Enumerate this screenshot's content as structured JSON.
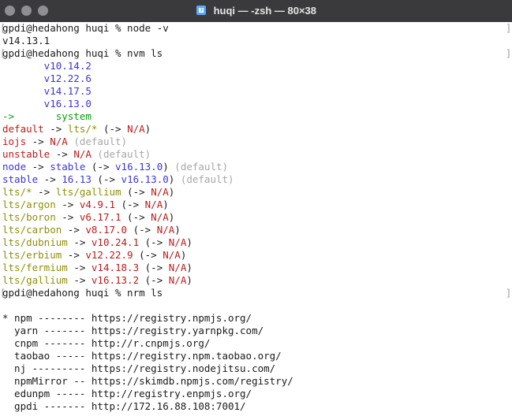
{
  "window": {
    "title": "huqi — -zsh — 80×38",
    "icon": "folder-document-icon",
    "colors": {
      "titlebar": "#3a3a3c",
      "blue": "#3b35d6",
      "green": "#0f9a0f",
      "red": "#b91c1c",
      "olive": "#8f8f0c",
      "gray": "#a7a7a7"
    }
  },
  "terminal": {
    "lines": [
      {
        "segments": [
          {
            "text": "gpdi@hedahong huqi % node -v",
            "color": "dark"
          }
        ],
        "bracket": true,
        "right_bracket": true
      },
      {
        "segments": [
          {
            "text": "v14.13.1",
            "color": "dark"
          }
        ]
      },
      {
        "segments": [
          {
            "text": "gpdi@hedahong huqi % nvm ls",
            "color": "dark"
          }
        ],
        "bracket": true,
        "right_bracket": true
      },
      {
        "segments": [
          {
            "text": "       v10.14.2",
            "color": "blue"
          }
        ]
      },
      {
        "segments": [
          {
            "text": "       v12.22.6",
            "color": "blue"
          }
        ]
      },
      {
        "segments": [
          {
            "text": "       v14.17.5",
            "color": "blue"
          }
        ]
      },
      {
        "segments": [
          {
            "text": "       v16.13.0",
            "color": "blue"
          }
        ]
      },
      {
        "segments": [
          {
            "text": "->       system",
            "color": "green"
          }
        ]
      },
      {
        "segments": [
          {
            "text": "default",
            "color": "red"
          },
          {
            "text": " -> ",
            "color": "dark"
          },
          {
            "text": "lts/*",
            "color": "olive"
          },
          {
            "text": " (-> ",
            "color": "dark"
          },
          {
            "text": "N/A",
            "color": "red"
          },
          {
            "text": ")",
            "color": "dark"
          }
        ]
      },
      {
        "segments": [
          {
            "text": "iojs",
            "color": "red"
          },
          {
            "text": " -> ",
            "color": "dark"
          },
          {
            "text": "N/A",
            "color": "red"
          },
          {
            "text": " (default)",
            "color": "gray"
          }
        ]
      },
      {
        "segments": [
          {
            "text": "unstable",
            "color": "red"
          },
          {
            "text": " -> ",
            "color": "dark"
          },
          {
            "text": "N/A",
            "color": "red"
          },
          {
            "text": " (default)",
            "color": "gray"
          }
        ]
      },
      {
        "segments": [
          {
            "text": "node",
            "color": "blue"
          },
          {
            "text": " -> ",
            "color": "dark"
          },
          {
            "text": "stable",
            "color": "blue"
          },
          {
            "text": " (-> ",
            "color": "dark"
          },
          {
            "text": "v16.13.0",
            "color": "blue"
          },
          {
            "text": ")",
            "color": "dark"
          },
          {
            "text": " (default)",
            "color": "gray"
          }
        ]
      },
      {
        "segments": [
          {
            "text": "stable",
            "color": "blue"
          },
          {
            "text": " -> ",
            "color": "dark"
          },
          {
            "text": "16.13",
            "color": "blue"
          },
          {
            "text": " (-> ",
            "color": "dark"
          },
          {
            "text": "v16.13.0",
            "color": "blue"
          },
          {
            "text": ")",
            "color": "dark"
          },
          {
            "text": " (default)",
            "color": "gray"
          }
        ]
      },
      {
        "segments": [
          {
            "text": "lts/*",
            "color": "olive"
          },
          {
            "text": " -> ",
            "color": "dark"
          },
          {
            "text": "lts/gallium",
            "color": "olive"
          },
          {
            "text": " (-> ",
            "color": "dark"
          },
          {
            "text": "N/A",
            "color": "red"
          },
          {
            "text": ")",
            "color": "dark"
          }
        ]
      },
      {
        "segments": [
          {
            "text": "lts/argon",
            "color": "olive"
          },
          {
            "text": " -> ",
            "color": "dark"
          },
          {
            "text": "v4.9.1",
            "color": "red"
          },
          {
            "text": " (-> ",
            "color": "dark"
          },
          {
            "text": "N/A",
            "color": "red"
          },
          {
            "text": ")",
            "color": "dark"
          }
        ]
      },
      {
        "segments": [
          {
            "text": "lts/boron",
            "color": "olive"
          },
          {
            "text": " -> ",
            "color": "dark"
          },
          {
            "text": "v6.17.1",
            "color": "red"
          },
          {
            "text": " (-> ",
            "color": "dark"
          },
          {
            "text": "N/A",
            "color": "red"
          },
          {
            "text": ")",
            "color": "dark"
          }
        ]
      },
      {
        "segments": [
          {
            "text": "lts/carbon",
            "color": "olive"
          },
          {
            "text": " -> ",
            "color": "dark"
          },
          {
            "text": "v8.17.0",
            "color": "red"
          },
          {
            "text": " (-> ",
            "color": "dark"
          },
          {
            "text": "N/A",
            "color": "red"
          },
          {
            "text": ")",
            "color": "dark"
          }
        ]
      },
      {
        "segments": [
          {
            "text": "lts/dubnium",
            "color": "olive"
          },
          {
            "text": " -> ",
            "color": "dark"
          },
          {
            "text": "v10.24.1",
            "color": "red"
          },
          {
            "text": " (-> ",
            "color": "dark"
          },
          {
            "text": "N/A",
            "color": "red"
          },
          {
            "text": ")",
            "color": "dark"
          }
        ]
      },
      {
        "segments": [
          {
            "text": "lts/erbium",
            "color": "olive"
          },
          {
            "text": " -> ",
            "color": "dark"
          },
          {
            "text": "v12.22.9",
            "color": "red"
          },
          {
            "text": " (-> ",
            "color": "dark"
          },
          {
            "text": "N/A",
            "color": "red"
          },
          {
            "text": ")",
            "color": "dark"
          }
        ]
      },
      {
        "segments": [
          {
            "text": "lts/fermium",
            "color": "olive"
          },
          {
            "text": " -> ",
            "color": "dark"
          },
          {
            "text": "v14.18.3",
            "color": "red"
          },
          {
            "text": " (-> ",
            "color": "dark"
          },
          {
            "text": "N/A",
            "color": "red"
          },
          {
            "text": ")",
            "color": "dark"
          }
        ]
      },
      {
        "segments": [
          {
            "text": "lts/gallium",
            "color": "olive"
          },
          {
            "text": " -> ",
            "color": "dark"
          },
          {
            "text": "v16.13.2",
            "color": "red"
          },
          {
            "text": " (-> ",
            "color": "dark"
          },
          {
            "text": "N/A",
            "color": "red"
          },
          {
            "text": ")",
            "color": "dark"
          }
        ]
      },
      {
        "segments": [
          {
            "text": "gpdi@hedahong huqi % nrm ls",
            "color": "dark"
          }
        ],
        "bracket": true,
        "right_bracket": true
      },
      {
        "segments": [
          {
            "text": "",
            "color": "dark"
          }
        ]
      },
      {
        "segments": [
          {
            "text": "* npm -------- https://registry.npmjs.org/",
            "color": "dark"
          }
        ]
      },
      {
        "segments": [
          {
            "text": "  yarn ------- https://registry.yarnpkg.com/",
            "color": "dark"
          }
        ]
      },
      {
        "segments": [
          {
            "text": "  cnpm ------- http://r.cnpmjs.org/",
            "color": "dark"
          }
        ]
      },
      {
        "segments": [
          {
            "text": "  taobao ----- https://registry.npm.taobao.org/",
            "color": "dark"
          }
        ]
      },
      {
        "segments": [
          {
            "text": "  nj --------- https://registry.nodejitsu.com/",
            "color": "dark"
          }
        ]
      },
      {
        "segments": [
          {
            "text": "  npmMirror -- https://skimdb.npmjs.com/registry/",
            "color": "dark"
          }
        ]
      },
      {
        "segments": [
          {
            "text": "  edunpm ----- http://registry.enpmjs.org/",
            "color": "dark"
          }
        ]
      },
      {
        "segments": [
          {
            "text": "  gpdi ------- http://172.16.88.108:7001/",
            "color": "dark"
          }
        ]
      }
    ]
  }
}
